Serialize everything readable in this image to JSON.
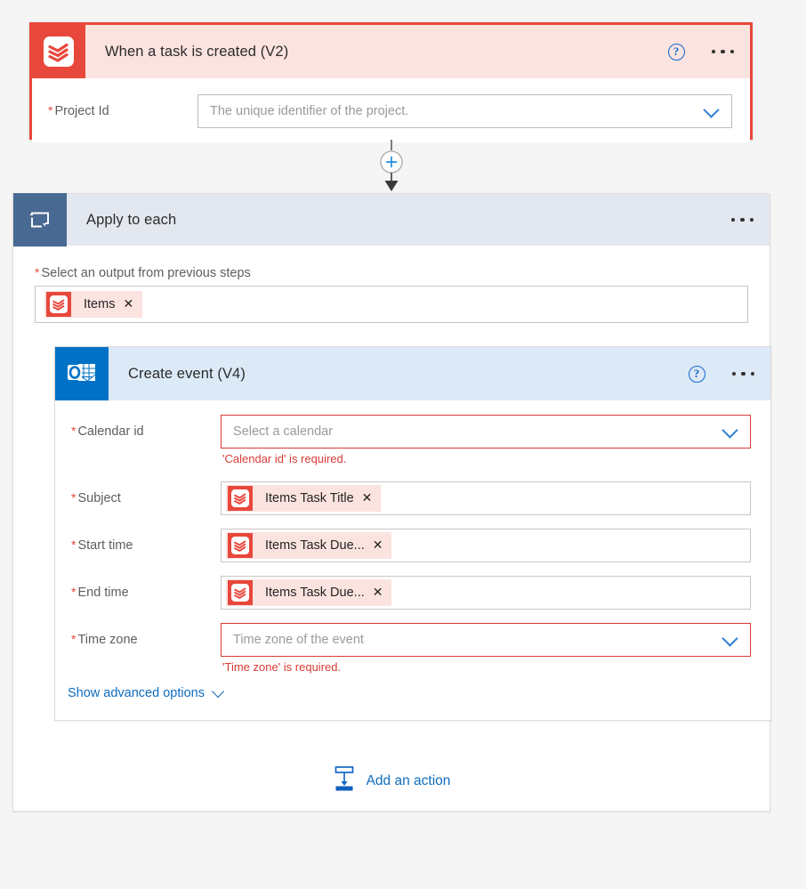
{
  "trigger": {
    "icon": "todoist-icon",
    "title": "When a task is created (V2)",
    "help_icon": "help-icon",
    "menu_icon": "more-options-icon",
    "fields": [
      {
        "label": "Project Id",
        "required": true,
        "placeholder": "The unique identifier of the project.",
        "value": "",
        "dropdown_icon": "chevron-down-icon"
      }
    ]
  },
  "connector": {
    "add_icon": "plus-circle-icon",
    "arrow_icon": "arrow-down-icon"
  },
  "loop": {
    "icon": "loop-icon",
    "title": "Apply to each",
    "menu_icon": "more-options-icon",
    "output_label": "Select an output from previous steps",
    "output_required": true,
    "output_token": {
      "icon": "todoist-icon",
      "text": "Items",
      "remove_icon": "remove-token-icon"
    }
  },
  "action": {
    "icon": "outlook-calendar-icon",
    "title": "Create event (V4)",
    "help_icon": "help-icon",
    "menu_icon": "more-options-icon",
    "fields": [
      {
        "label": "Calendar id",
        "required": true,
        "kind": "dropdown",
        "placeholder": "Select a calendar",
        "value": "",
        "error": "'Calendar id' is required.",
        "dropdown_icon": "chevron-down-icon"
      },
      {
        "label": "Subject",
        "required": true,
        "kind": "token",
        "token": {
          "icon": "todoist-icon",
          "text": "Items Task Title",
          "remove_icon": "remove-token-icon"
        }
      },
      {
        "label": "Start time",
        "required": true,
        "kind": "token",
        "token": {
          "icon": "todoist-icon",
          "text": "Items Task Due...",
          "remove_icon": "remove-token-icon"
        }
      },
      {
        "label": "End time",
        "required": true,
        "kind": "token",
        "token": {
          "icon": "todoist-icon",
          "text": "Items Task Due...",
          "remove_icon": "remove-token-icon"
        }
      },
      {
        "label": "Time zone",
        "required": true,
        "kind": "dropdown",
        "placeholder": "Time zone of the event",
        "value": "",
        "error": "'Time zone' is required.",
        "dropdown_icon": "chevron-down-icon"
      }
    ],
    "advanced_options_label": "Show advanced options",
    "advanced_options_icon": "chevron-down-icon"
  },
  "add_action": {
    "label": "Add an action",
    "icon": "add-action-icon"
  },
  "colors": {
    "todoist_red": "#e8483c",
    "trigger_header_bg": "#fbe3e0",
    "outlook_blue": "#0072c6",
    "action_header_bg": "#dce9f7",
    "loop_blue": "#486991",
    "loop_header_bg": "#e3e8f0",
    "link_blue": "#0f6cbd",
    "error_red": "#d63b34",
    "canvas_bg": "#f5f5f5"
  }
}
